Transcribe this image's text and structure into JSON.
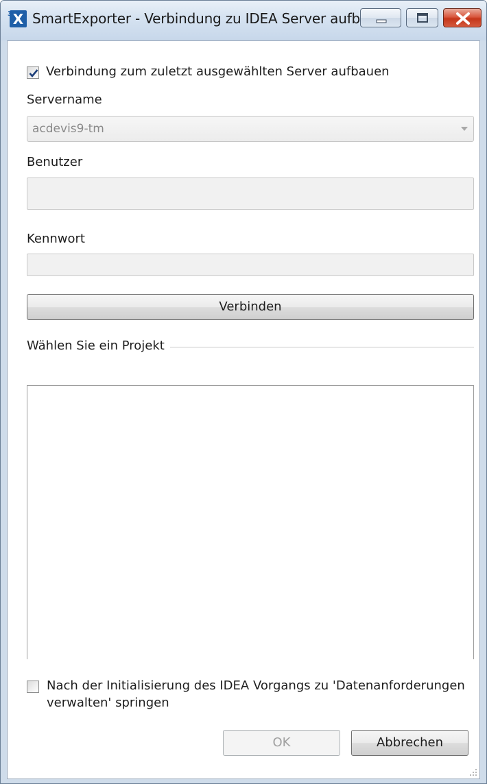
{
  "window": {
    "title": "SmartExporter - Verbindung zu IDEA Server aufbauen",
    "app_icon_text": "X",
    "app_icon_superscript": "3",
    "accent_color": "#1f5fa8",
    "close_color": "#c9391b"
  },
  "form": {
    "reconnect_checkbox": {
      "label": "Verbindung zum zuletzt ausgewählten Server aufbauen",
      "checked": true
    },
    "servername": {
      "label": "Servername",
      "value": "acdevis9-tm"
    },
    "benutzer": {
      "label": "Benutzer",
      "value": ""
    },
    "kennwort": {
      "label": "Kennwort",
      "value": ""
    },
    "connect_button": "Verbinden",
    "project_group": {
      "label": "Wählen Sie ein Projekt",
      "items": []
    },
    "navigate_checkbox": {
      "label": "Nach der Initialisierung des IDEA Vorgangs zu 'Datenanforderungen verwalten' springen",
      "checked": false
    }
  },
  "footer": {
    "ok_button": "OK",
    "cancel_button": "Abbrechen"
  }
}
